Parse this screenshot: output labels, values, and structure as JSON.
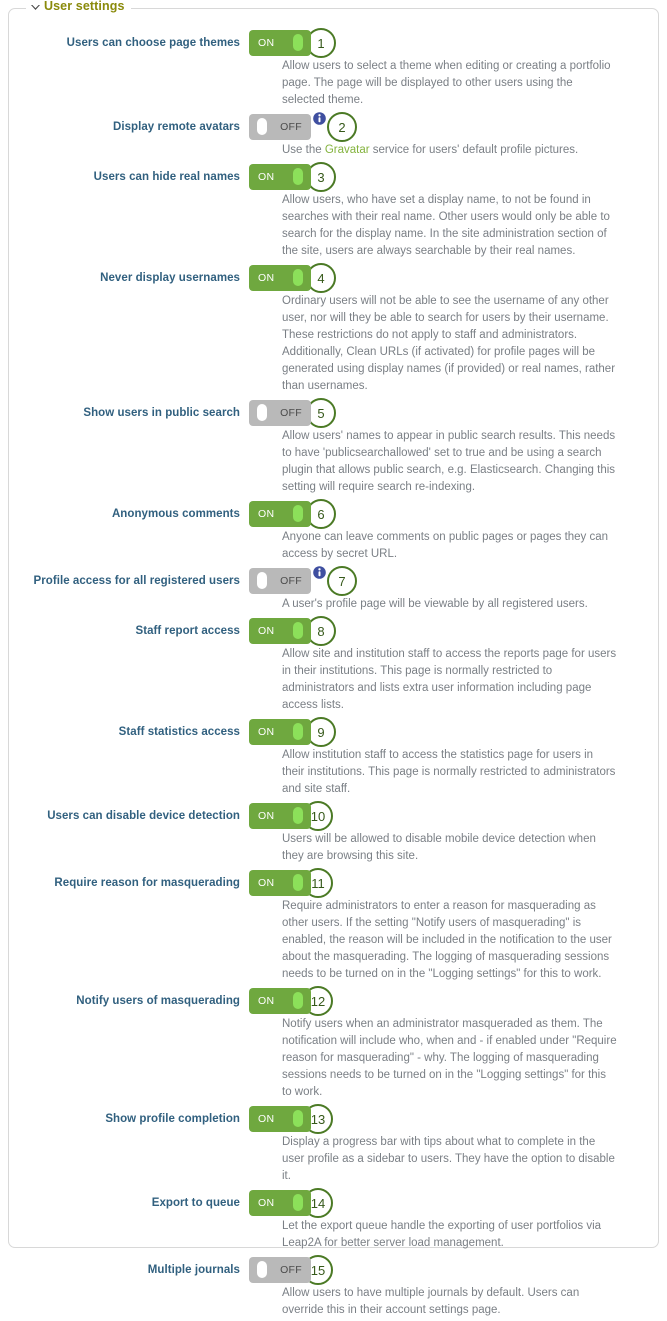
{
  "panel": {
    "legend": "User settings",
    "chevron_icon": "chevron-down-icon",
    "accent_legend_color": "#8a8a0b",
    "label_color": "#31607f",
    "toggle_on_color": "#6fa83f",
    "toggle_off_color": "#b9b9b9",
    "badge_border_color": "#4b7a25",
    "link_color": "#84b33e"
  },
  "toggle_labels": {
    "on": "ON",
    "off": "OFF"
  },
  "settings": [
    {
      "badge": "1",
      "label": "Users can choose page themes",
      "state": "on",
      "info": false,
      "description": "Allow users to select a theme when editing or creating a portfolio page. The page will be displayed to other users using the selected theme."
    },
    {
      "badge": "2",
      "label": "Display remote avatars",
      "state": "off",
      "info": true,
      "description_prefix": "Use the ",
      "description_link": "Gravatar",
      "description_suffix": " service for users' default profile pictures.",
      "description": "Use the Gravatar service for users' default profile pictures."
    },
    {
      "badge": "3",
      "label": "Users can hide real names",
      "state": "on",
      "info": false,
      "description": "Allow users, who have set a display name, to not be found in searches with their real name. Other users would only be able to search for the display name. In the site administration section of the site, users are always searchable by their real names."
    },
    {
      "badge": "4",
      "label": "Never display usernames",
      "state": "on",
      "info": false,
      "description": "Ordinary users will not be able to see the username of any other user, nor will they be able to search for users by their username. These restrictions do not apply to staff and administrators. Additionally, Clean URLs (if activated) for profile pages will be generated using display names (if provided) or real names, rather than usernames."
    },
    {
      "badge": "5",
      "label": "Show users in public search",
      "state": "off",
      "info": false,
      "description": "Allow users' names to appear in public search results. This needs to have 'publicsearchallowed' set to true and be using a search plugin that allows public search, e.g. Elasticsearch. Changing this setting will require search re-indexing."
    },
    {
      "badge": "6",
      "label": "Anonymous comments",
      "state": "on",
      "info": false,
      "description": "Anyone can leave comments on public pages or pages they can access by secret URL."
    },
    {
      "badge": "7",
      "label": "Profile access for all registered users",
      "state": "off",
      "info": true,
      "description": "A user's profile page will be viewable by all registered users."
    },
    {
      "badge": "8",
      "label": "Staff report access",
      "state": "on",
      "info": false,
      "description": "Allow site and institution staff to access the reports page for users in their institutions. This page is normally restricted to administrators and lists extra user information including page access lists."
    },
    {
      "badge": "9",
      "label": "Staff statistics access",
      "state": "on",
      "info": false,
      "description": "Allow institution staff to access the statistics page for users in their institutions. This page is normally restricted to administrators and site staff."
    },
    {
      "badge": "10",
      "label": "Users can disable device detection",
      "state": "on",
      "info": false,
      "description": "Users will be allowed to disable mobile device detection when they are browsing this site."
    },
    {
      "badge": "11",
      "label": "Require reason for masquerading",
      "state": "on",
      "info": false,
      "description": "Require administrators to enter a reason for masquerading as other users. If the setting \"Notify users of masquerading\" is enabled, the reason will be included in the notification to the user about the masquerading. The logging of masquerading sessions needs to be turned on in the \"Logging settings\" for this to work."
    },
    {
      "badge": "12",
      "label": "Notify users of masquerading",
      "state": "on",
      "info": false,
      "description": "Notify users when an administrator masqueraded as them. The notification will include who, when and - if enabled under \"Require reason for masquerading\" - why. The logging of masquerading sessions needs to be turned on in the \"Logging settings\" for this to work."
    },
    {
      "badge": "13",
      "label": "Show profile completion",
      "state": "on",
      "info": false,
      "description": "Display a progress bar with tips about what to complete in the user profile as a sidebar to users. They have the option to disable it."
    },
    {
      "badge": "14",
      "label": "Export to queue",
      "state": "on",
      "info": false,
      "description": "Let the export queue handle the exporting of user portfolios via Leap2A for better server load management."
    },
    {
      "badge": "15",
      "label": "Multiple journals",
      "state": "off",
      "info": false,
      "description": "Allow users to have multiple journals by default. Users can override this in their account settings page."
    }
  ]
}
